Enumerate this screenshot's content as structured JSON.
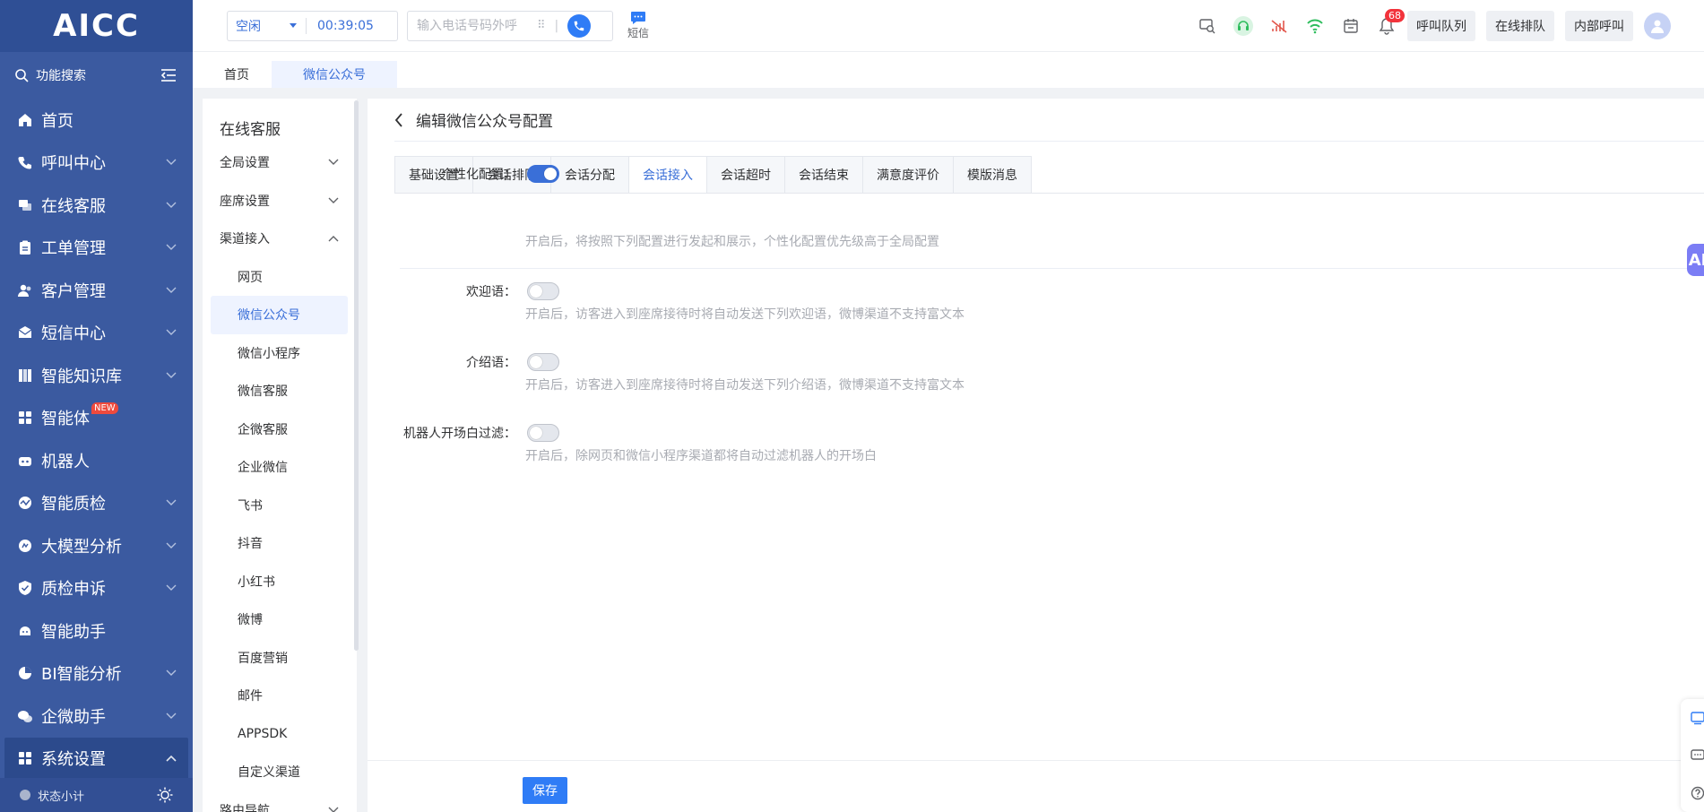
{
  "app": {
    "logo": "AICC"
  },
  "sidebar": {
    "search_label": "功能搜索",
    "items": [
      {
        "label": "首页",
        "chevron": false
      },
      {
        "label": "呼叫中心",
        "chevron": true
      },
      {
        "label": "在线客服",
        "chevron": true
      },
      {
        "label": "工单管理",
        "chevron": true
      },
      {
        "label": "客户管理",
        "chevron": true
      },
      {
        "label": "短信中心",
        "chevron": true
      },
      {
        "label": "智能知识库",
        "chevron": true
      },
      {
        "label": "智能体",
        "chevron": false,
        "badge": "NEW"
      },
      {
        "label": "机器人",
        "chevron": false
      },
      {
        "label": "智能质检",
        "chevron": true
      },
      {
        "label": "大模型分析",
        "chevron": true
      },
      {
        "label": "质检申诉",
        "chevron": true
      },
      {
        "label": "智能助手",
        "chevron": false
      },
      {
        "label": "BI智能分析",
        "chevron": true
      },
      {
        "label": "企微助手",
        "chevron": true
      },
      {
        "label": "系统设置",
        "chevron": true,
        "expanded": true
      }
    ],
    "footer_label": "状态小计"
  },
  "topbar": {
    "status": "空闲",
    "timer": "00:39:05",
    "dial_placeholder": "输入电话号码外呼",
    "sms_label": "短信",
    "bell_count": "68",
    "buttons": [
      "呼叫队列",
      "在线排队",
      "内部呼叫"
    ]
  },
  "page_tabs": [
    "首页",
    "微信公众号"
  ],
  "submenu": {
    "title": "在线客服",
    "groups": [
      {
        "label": "全局设置",
        "expanded": false
      },
      {
        "label": "座席设置",
        "expanded": false
      },
      {
        "label": "渠道接入",
        "expanded": true
      }
    ],
    "channel_items": [
      "网页",
      "微信公众号",
      "微信小程序",
      "微信客服",
      "企微客服",
      "企业微信",
      "飞书",
      "抖音",
      "小红书",
      "微博",
      "百度营销",
      "邮件",
      "APPSDK",
      "自定义渠道"
    ],
    "active_item": "微信公众号",
    "next_group": "路由导航"
  },
  "main": {
    "title": "编辑微信公众号配置",
    "tabs": [
      "基础设置",
      "会话排队",
      "会话分配",
      "会话接入",
      "会话超时",
      "会话结束",
      "满意度评价",
      "模版消息"
    ],
    "active_tab": "会话接入",
    "settings": [
      {
        "label": "个性化配置：",
        "on": true,
        "hint": "开启后，将按照下列配置进行发起和展示，个性化配置优先级高于全局配置"
      },
      {
        "label": "欢迎语：",
        "on": false,
        "hint": "开启后，访客进入到座席接待时将自动发送下列欢迎语，微博渠道不支持富文本"
      },
      {
        "label": "介绍语：",
        "on": false,
        "hint": "开启后，访客进入到座席接待时将自动发送下列介绍语，微博渠道不支持富文本"
      },
      {
        "label": "机器人开场白过滤：",
        "on": false,
        "hint": "开启后，除网页和微信小程序渠道都将自动过滤机器人的开场白"
      }
    ],
    "save_label": "保存"
  },
  "floating": {
    "ai_label": "AI"
  },
  "colors": {
    "sidebar_bg": "#3b5aa0",
    "accent": "#3a6fd8",
    "primary_button": "#2f7cf6",
    "badge_red": "#f2333b"
  }
}
